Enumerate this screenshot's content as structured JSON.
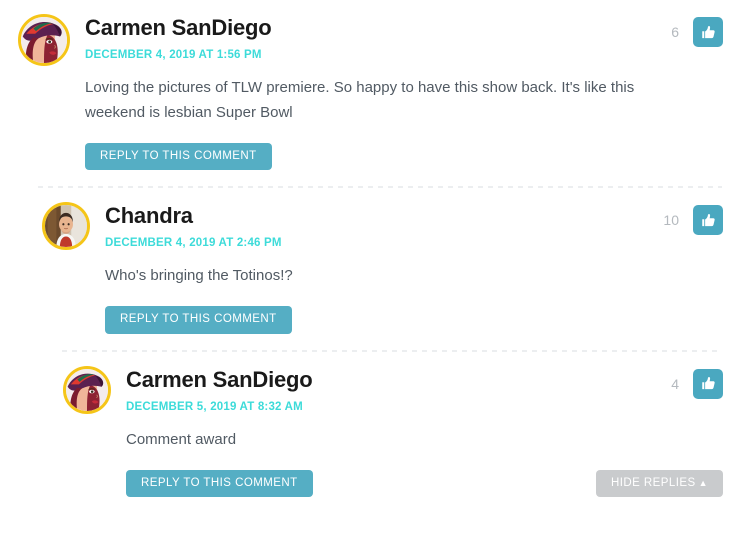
{
  "theme": {
    "accent_teal": "#55aec4",
    "date_cyan": "#3ddbd9",
    "avatar_ring": "#f5c518",
    "hide_button_gray": "#c9cbcd",
    "body_text": "#515a63"
  },
  "comments": [
    {
      "id": "comment-1",
      "level": 0,
      "author": "Carmen SanDiego",
      "avatar_icon": "carmen-sandiego-avatar",
      "date": "DECEMBER 4, 2019 AT 1:56 PM",
      "body": "Loving the pictures of TLW premiere. So happy to have this show back. It's like this weekend is lesbian Super Bowl",
      "like_count": "6",
      "like_icon": "thumbs-up-icon",
      "reply_label": "REPLY TO THIS COMMENT",
      "hide_replies_label": null
    },
    {
      "id": "comment-2",
      "level": 1,
      "author": "Chandra",
      "avatar_icon": "chandra-photo-avatar",
      "date": "DECEMBER 4, 2019 AT 2:46 PM",
      "body": "Who's bringing the Totinos!?",
      "like_count": "10",
      "like_icon": "thumbs-up-icon",
      "reply_label": "REPLY TO THIS COMMENT",
      "hide_replies_label": null
    },
    {
      "id": "comment-3",
      "level": 2,
      "author": "Carmen SanDiego",
      "avatar_icon": "carmen-sandiego-avatar",
      "date": "DECEMBER 5, 2019 AT 8:32 AM",
      "body": "Comment award",
      "like_count": "4",
      "like_icon": "thumbs-up-icon",
      "reply_label": "REPLY TO THIS COMMENT",
      "hide_replies_label": "HIDE REPLIES",
      "hide_replies_caret": "▲"
    }
  ]
}
